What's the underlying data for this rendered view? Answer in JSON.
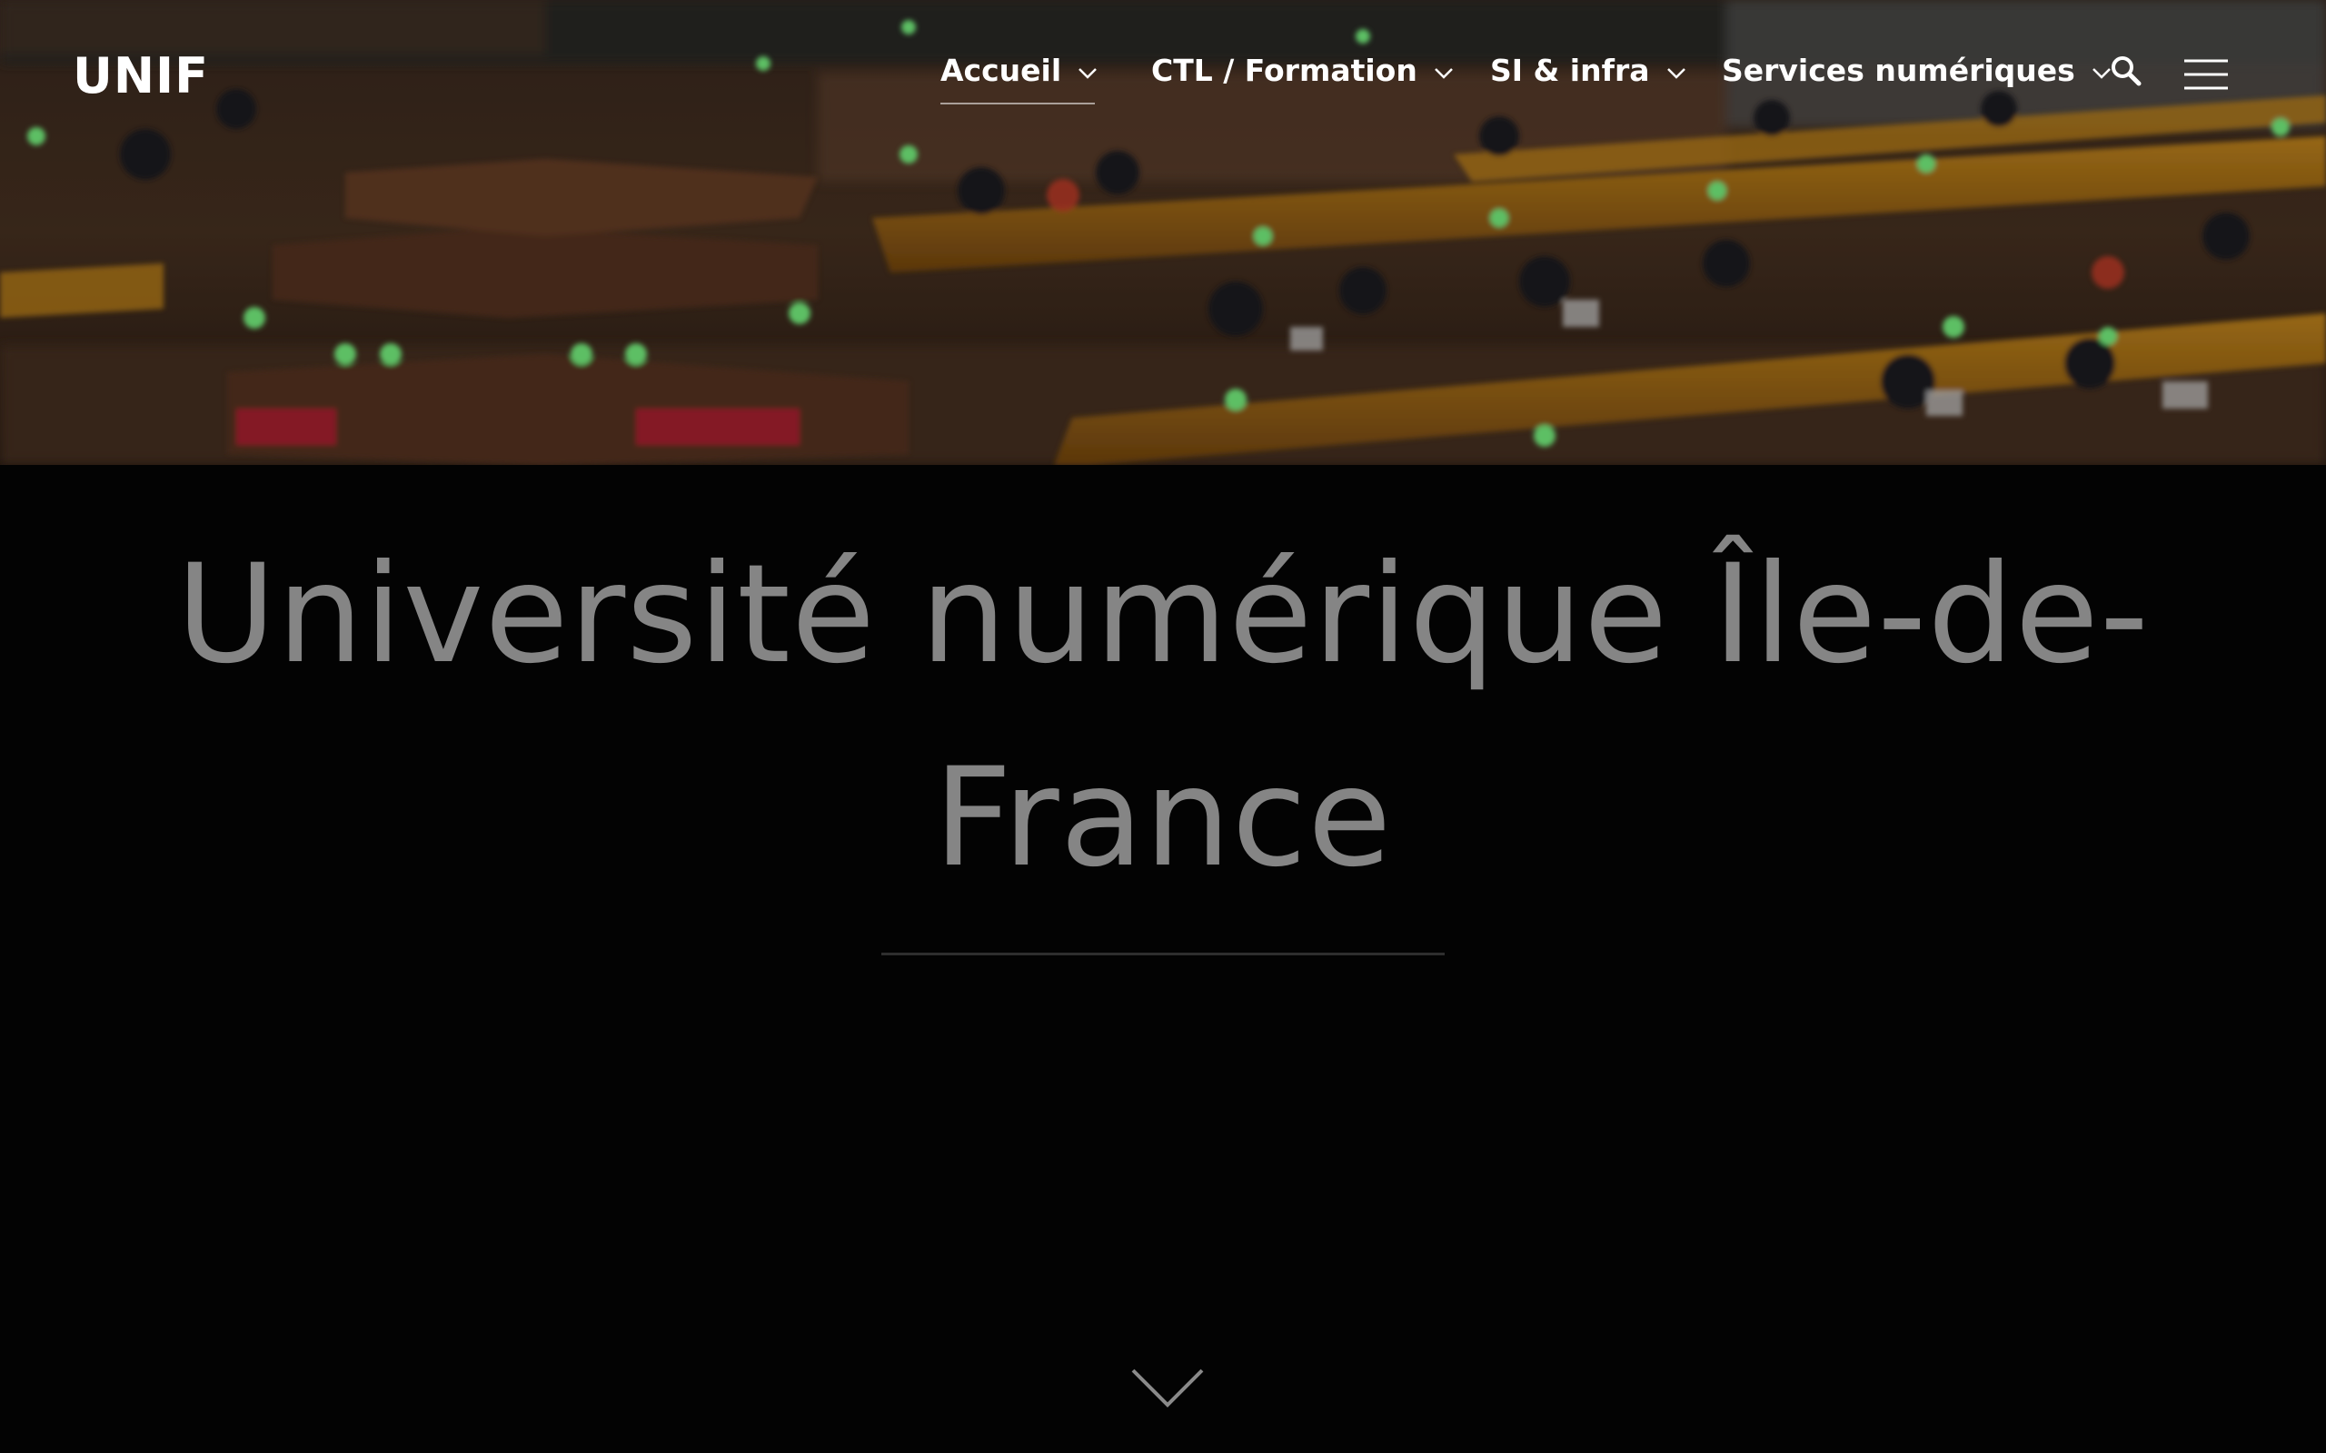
{
  "header": {
    "logo": "UNIF",
    "nav": [
      {
        "label": "Accueil",
        "active": true
      },
      {
        "label": "CTL / Formation",
        "active": false
      },
      {
        "label": "SI & infra",
        "active": false
      },
      {
        "label": "Services numériques",
        "active": false
      }
    ],
    "icons": [
      "chevron-down-icon",
      "search-icon",
      "hamburger-menu-icon"
    ]
  },
  "hero": {
    "image": "library-reading-room-photo"
  },
  "main": {
    "title": "Université numérique Île-de-France",
    "scroll_icon": "chevron-down-icon"
  },
  "colors": {
    "background": "#030303",
    "title": "#858585",
    "nav_text": "#ffffff",
    "divider": "#2e2e2e"
  }
}
